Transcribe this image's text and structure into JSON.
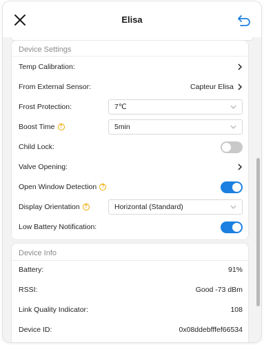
{
  "header": {
    "title": "Elisa",
    "close_icon": "close-icon",
    "back_icon": "undo-arrow-icon",
    "accent_color": "#1b7fe0"
  },
  "device_settings": {
    "section_title": "Device Settings",
    "temp_calibration": {
      "label": "Temp Calibration:"
    },
    "external_sensor": {
      "label": "From External Sensor:",
      "value": "Capteur Elisa"
    },
    "frost_protection": {
      "label": "Frost Protection:",
      "value": "7℃"
    },
    "boost_time": {
      "label": "Boost Time",
      "value": "5min"
    },
    "child_lock": {
      "label": "Child Lock:",
      "on": false
    },
    "valve_opening": {
      "label": "Valve Opening:"
    },
    "open_window_detection": {
      "label": "Open Window Detection",
      "on": true
    },
    "display_orientation": {
      "label": "Display Orientation",
      "value": "Horizontal (Standard)"
    },
    "low_battery_notification": {
      "label": "Low Battery Notification:",
      "on": true
    }
  },
  "device_info": {
    "section_title": "Device Info",
    "battery": {
      "label": "Battery:",
      "value": "91%"
    },
    "rssi": {
      "label": "RSSI:",
      "value": "Good -73 dBm",
      "color": "#e6a100"
    },
    "lqi": {
      "label": "Link Quality Indicator:",
      "value": "108"
    },
    "device_id": {
      "label": "Device ID:",
      "value": "0x08ddebfffef66534"
    }
  }
}
